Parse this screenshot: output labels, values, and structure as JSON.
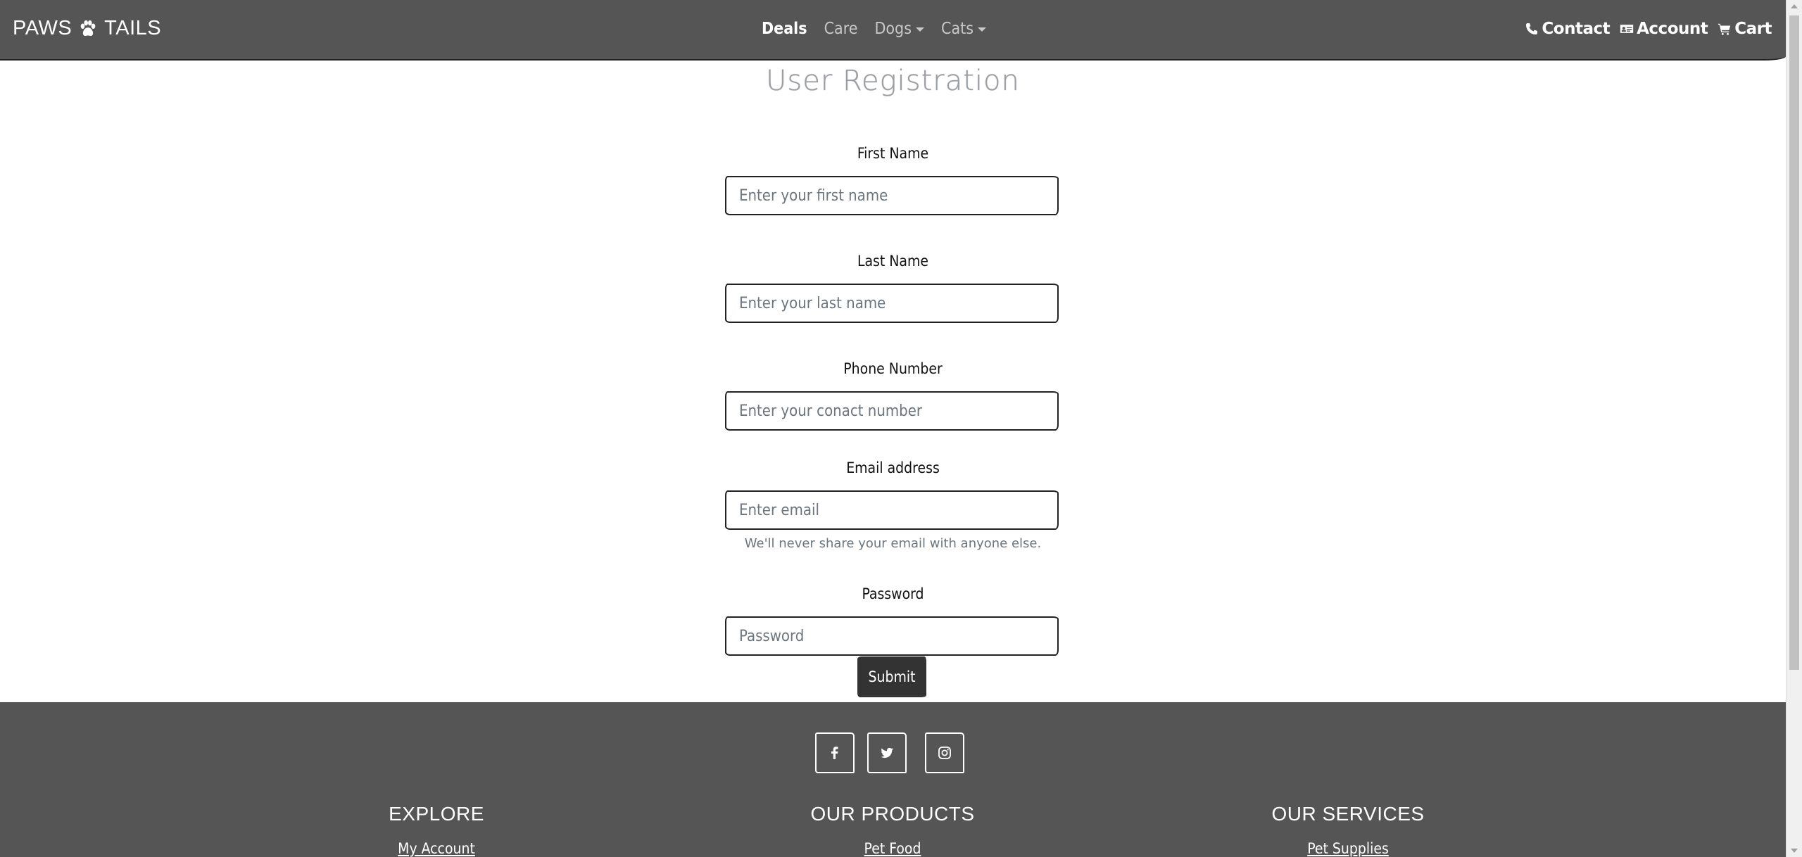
{
  "navbar": {
    "brand_left": "PAWS",
    "brand_right": "TAILS",
    "links": [
      "Deals",
      "Care",
      "Dogs",
      "Cats"
    ],
    "right": {
      "contact": "Contact",
      "account": "Account",
      "cart": "Cart"
    }
  },
  "form": {
    "title": "User Registration",
    "first_name": {
      "label": "First Name",
      "placeholder": "Enter your first name"
    },
    "last_name": {
      "label": "Last Name",
      "placeholder": "Enter your last name"
    },
    "phone": {
      "label": "Phone Number",
      "placeholder": "Enter your conact number"
    },
    "email": {
      "label": "Email address",
      "placeholder": "Enter email",
      "help": "We'll never share your email with anyone else."
    },
    "password": {
      "label": "Password",
      "placeholder": "Password"
    },
    "submit": "Submit"
  },
  "footer": {
    "social": [
      "facebook-icon",
      "twitter-icon",
      "instagram-icon"
    ],
    "columns": [
      {
        "heading": "EXPLORE",
        "first_link": "My Account"
      },
      {
        "heading": "OUR PRODUCTS",
        "first_link": "Pet Food"
      },
      {
        "heading": "OUR SERVICES",
        "first_link": "Pet Supplies"
      }
    ]
  },
  "colors": {
    "navbar_bg": "#555555",
    "footer_bg": "#555555",
    "submit_bg": "#333333",
    "title": "#9a9ea3",
    "help_text": "#6c757d"
  }
}
